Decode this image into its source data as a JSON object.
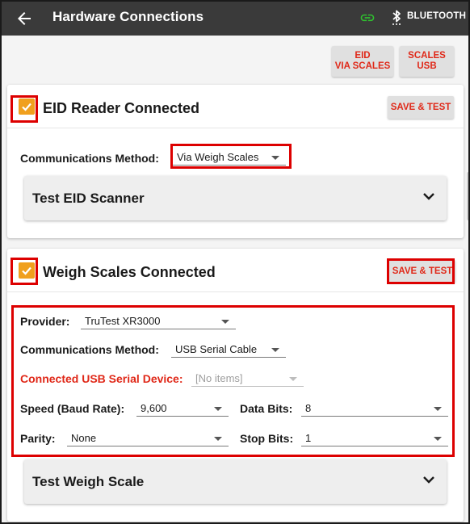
{
  "appbar": {
    "title": "Hardware Connections",
    "back_icon": "arrow-left-icon",
    "link_icon": "link-icon",
    "link_color": "#2fbf2f",
    "bluetooth_icon": "bluetooth-icon",
    "bluetooth_label": "BLUETOOTH"
  },
  "top_buttons": [
    {
      "line1": "EID",
      "line2": "VIA SCALES"
    },
    {
      "line1": "SCALES",
      "line2": "USB"
    }
  ],
  "eid_card": {
    "checked": true,
    "title": "EID Reader Connected",
    "save_label": "SAVE & TEST",
    "comm_label": "Communications Method:",
    "comm_value": "Via Weigh Scales",
    "accordion_title": "Test EID Scanner"
  },
  "scales_card": {
    "checked": true,
    "title": "Weigh Scales Connected",
    "save_label": "SAVE & TEST",
    "provider_label": "Provider:",
    "provider_value": "TruTest XR3000",
    "comm_label": "Communications Method:",
    "comm_value": "USB Serial Cable",
    "usb_label": "Connected USB Serial Device:",
    "usb_value": "[No items]",
    "speed_label": "Speed (Baud Rate):",
    "speed_value": "9,600",
    "databits_label": "Data Bits:",
    "databits_value": "8",
    "parity_label": "Parity:",
    "parity_value": "None",
    "stopbits_label": "Stop Bits:",
    "stopbits_value": "1",
    "accordion_title": "Test Weigh Scale"
  },
  "colors": {
    "appbar": "#3a3a3a",
    "accent_red": "#e02818",
    "checkbox": "#f0a01e",
    "highlight_box": "#dd0000"
  }
}
